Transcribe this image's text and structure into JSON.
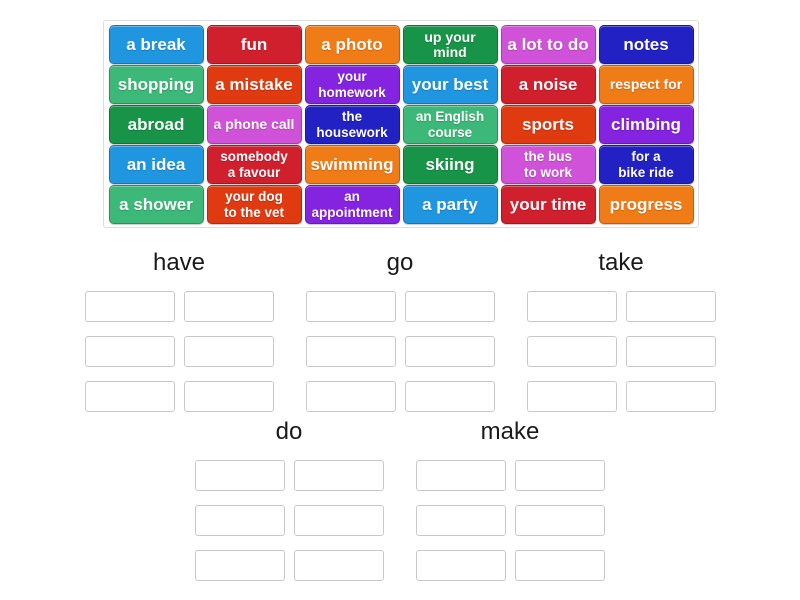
{
  "activity": {
    "type": "group-sort",
    "tile_bank": {
      "columns": 6,
      "rows": 5,
      "tiles": [
        [
          {
            "label": "a break",
            "color": "#2196e0",
            "lines": 1
          },
          {
            "label": "fun",
            "color": "#d0202e",
            "lines": 1
          },
          {
            "label": "a photo",
            "color": "#f07c18",
            "lines": 1
          },
          {
            "label": "up your mind",
            "color": "#189448",
            "lines": 1,
            "size": "small"
          },
          {
            "label": "a lot to do",
            "color": "#d052d8",
            "lines": 1
          },
          {
            "label": "notes",
            "color": "#2222c4",
            "lines": 1
          }
        ],
        [
          {
            "label": "shopping",
            "color": "#3cb878",
            "lines": 1
          },
          {
            "label": "a mistake",
            "color": "#e03a10",
            "lines": 1
          },
          {
            "label": "your\nhomework",
            "color": "#8423e0",
            "lines": 2
          },
          {
            "label": "your best",
            "color": "#2196e0",
            "lines": 1
          },
          {
            "label": "a noise",
            "color": "#d0202e",
            "lines": 1
          },
          {
            "label": "respect for",
            "color": "#f07c18",
            "lines": 1,
            "size": "small"
          }
        ],
        [
          {
            "label": "abroad",
            "color": "#189448",
            "lines": 1
          },
          {
            "label": "a phone call",
            "color": "#d052d8",
            "lines": 1,
            "size": "small"
          },
          {
            "label": "the\nhousework",
            "color": "#2222c4",
            "lines": 2
          },
          {
            "label": "an English\ncourse",
            "color": "#3cb878",
            "lines": 2
          },
          {
            "label": "sports",
            "color": "#e03a10",
            "lines": 1
          },
          {
            "label": "climbing",
            "color": "#8423e0",
            "lines": 1
          }
        ],
        [
          {
            "label": "an idea",
            "color": "#2196e0",
            "lines": 1
          },
          {
            "label": "somebody\na favour",
            "color": "#d0202e",
            "lines": 2
          },
          {
            "label": "swimming",
            "color": "#f07c18",
            "lines": 1
          },
          {
            "label": "skiing",
            "color": "#189448",
            "lines": 1
          },
          {
            "label": "the bus\nto work",
            "color": "#d052d8",
            "lines": 2
          },
          {
            "label": "for a\nbike ride",
            "color": "#2222c4",
            "lines": 2
          }
        ],
        [
          {
            "label": "a shower",
            "color": "#3cb878",
            "lines": 1
          },
          {
            "label": "your dog\nto the vet",
            "color": "#e03a10",
            "lines": 2
          },
          {
            "label": "an\nappointment",
            "color": "#8423e0",
            "lines": 2
          },
          {
            "label": "a party",
            "color": "#2196e0",
            "lines": 1
          },
          {
            "label": "your time",
            "color": "#d0202e",
            "lines": 1
          },
          {
            "label": "progress",
            "color": "#f07c18",
            "lines": 1
          }
        ]
      ]
    },
    "groups": [
      {
        "title": "have",
        "slots": 6,
        "slot_values": [
          "",
          "",
          "",
          "",
          "",
          ""
        ]
      },
      {
        "title": "go",
        "slots": 6,
        "slot_values": [
          "",
          "",
          "",
          "",
          "",
          ""
        ]
      },
      {
        "title": "take",
        "slots": 6,
        "slot_values": [
          "",
          "",
          "",
          "",
          "",
          ""
        ]
      },
      {
        "title": "do",
        "slots": 6,
        "slot_values": [
          "",
          "",
          "",
          "",
          "",
          ""
        ]
      },
      {
        "title": "make",
        "slots": 6,
        "slot_values": [
          "",
          "",
          "",
          "",
          "",
          ""
        ]
      }
    ],
    "colors": {
      "background": "#ffffff",
      "bank_border": "#dcdcdc",
      "slot_border": "#c9c9c9",
      "title_text": "#1a1a1a",
      "tile_text": "#ffffff"
    }
  }
}
